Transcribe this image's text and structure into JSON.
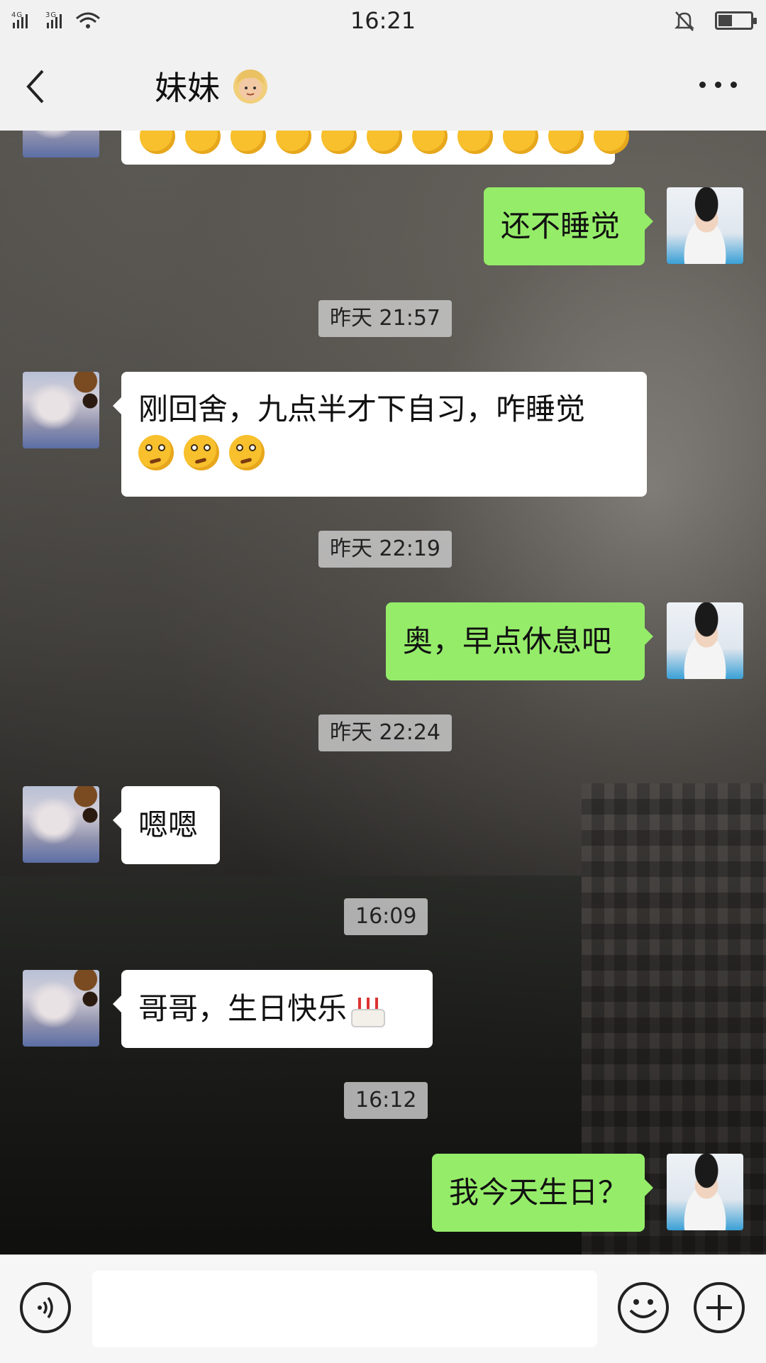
{
  "status_bar": {
    "signal_left": "4Gᴵᴵᴵ  3Gᴵᴵᴵ",
    "time": "16:21",
    "battery_level": 0.4
  },
  "header": {
    "back_icon": "chevron-left-icon",
    "title": "妹妹",
    "title_emoji": "👱🏼‍♀️",
    "more_icon": "more-icon"
  },
  "messages": {
    "m1": {
      "sender": "contact",
      "emoji_count": 11
    },
    "m2": {
      "sender": "me",
      "text": "还不睡觉"
    },
    "t1": "昨天 21:57",
    "m3": {
      "sender": "contact",
      "line1": "刚回舍，九点半才下自习，咋睡觉",
      "emoji_count": 3
    },
    "t2": "昨天 22:19",
    "m4": {
      "sender": "me",
      "text": "奥，早点休息吧"
    },
    "t3": "昨天 22:24",
    "m5": {
      "sender": "contact",
      "text": "嗯嗯"
    },
    "t4": "16:09",
    "m6": {
      "sender": "contact",
      "text": "哥哥，生日快乐"
    },
    "t5": "16:12",
    "m7": {
      "sender": "me",
      "text": "我今天生日？"
    }
  },
  "input_bar": {
    "voice_icon": "voice-icon",
    "emoji_icon": "smiley-icon",
    "plus_icon": "plus-icon",
    "input_value": ""
  },
  "colors": {
    "bubble_out": "#95ec69",
    "bubble_in": "#ffffff",
    "bar_bg": "#f1f1f1"
  }
}
